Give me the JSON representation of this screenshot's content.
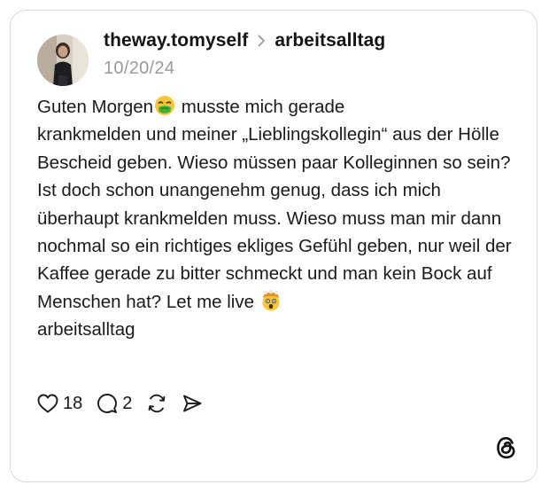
{
  "post": {
    "username": "theway.tomyself",
    "topic": "arbeitsalltag",
    "date": "10/20/24",
    "text_line1_a": "Guten Morgen",
    "text_line1_b": " musste mich gerade",
    "text_middle": "krankmelden und meiner „Lieblingskollegin“ aus der Hölle Bescheid geben. Wieso müssen paar Kolleginnen so sein? Ist doch schon unangenehm genug, dass ich mich überhaupt krankmelden muss. Wieso muss man mir dann nochmal so ein richtiges ekliges Gefühl geben, nur weil der Kaffee gerade zu bitter schmeckt und man kein Bock auf Menschen hat? Let me live",
    "hashtag": "arbeitsalltag"
  },
  "actions": {
    "likes": "18",
    "replies": "2"
  },
  "icons": {
    "avatar": "profile-photo",
    "separator": "chevron-right-icon",
    "emoji_1": "nauseated-face-emoji",
    "emoji_2": "exploding-head-emoji",
    "like": "heart-icon",
    "reply": "comment-icon",
    "repost": "repost-icon",
    "share": "send-icon",
    "brand": "threads-logo"
  },
  "colors": {
    "text": "#1a1a1a",
    "date": "#9a9a9a",
    "border": "#d9d9d9"
  }
}
